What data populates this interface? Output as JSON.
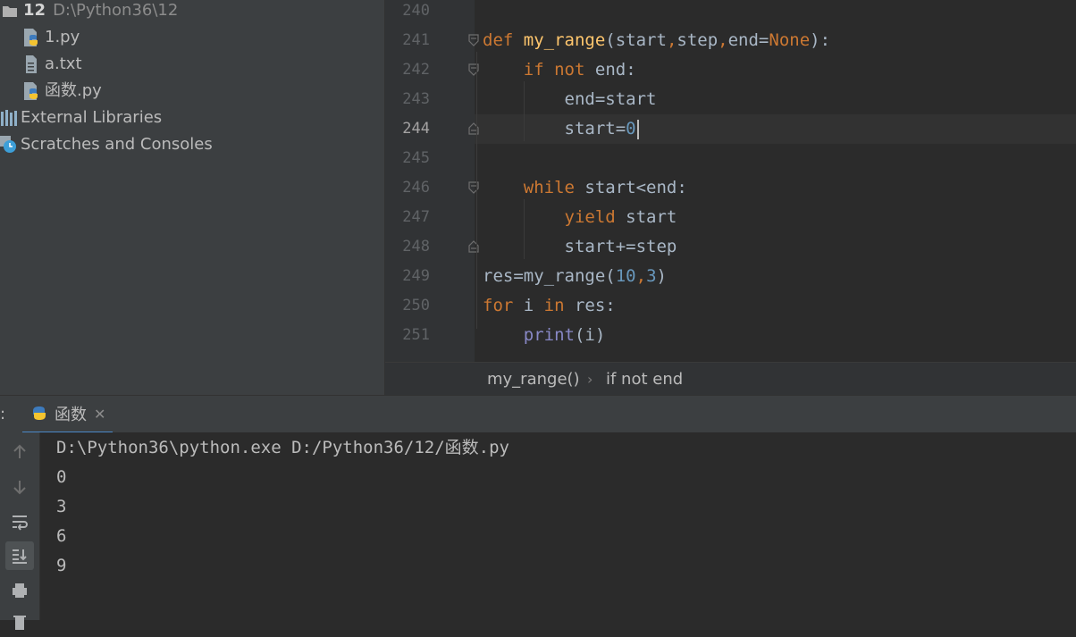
{
  "project": {
    "root_name": "12",
    "root_path": "D:\\Python36\\12",
    "files": [
      {
        "name": "1.py"
      },
      {
        "name": "a.txt"
      },
      {
        "name": "函数.py"
      }
    ],
    "external_libraries": "External Libraries",
    "scratches": "Scratches and Consoles"
  },
  "editor": {
    "line_numbers": [
      "240",
      "241",
      "242",
      "243",
      "244",
      "245",
      "246",
      "247",
      "248",
      "249",
      "250",
      "251"
    ],
    "current_line": "244",
    "code": {
      "l241": {
        "def": "def",
        "name": "my_range",
        "p1": "(start",
        "c1": ",",
        "p2": "step",
        "c2": ",",
        "p3": "end=",
        "none": "None",
        "end": "):"
      },
      "l242": {
        "if": "if",
        "not": "not",
        "rest": " end:"
      },
      "l243": "end=start",
      "l244": {
        "text": "start=",
        "num": "0"
      },
      "l246": {
        "while": "while",
        "rest": " start<end:"
      },
      "l247": {
        "yield": "yield",
        "rest": " start"
      },
      "l248": "start+=step",
      "l249": {
        "a": "res=my_range(",
        "n1": "10",
        "c": ",",
        "n2": "3",
        "b": ")"
      },
      "l250": {
        "for": "for",
        "i": " i ",
        "in": "in",
        "rest": " res:"
      },
      "l251": {
        "print": "print",
        "rest": "(i)"
      }
    }
  },
  "breadcrumb": {
    "items": [
      "my_range()",
      "if not end"
    ],
    "separator": "›"
  },
  "run": {
    "prefix": ":",
    "tab_label": "函数",
    "close": "✕",
    "output": [
      "D:\\Python36\\python.exe D:/Python36/12/函数.py",
      "0",
      "3",
      "6",
      "9"
    ]
  }
}
